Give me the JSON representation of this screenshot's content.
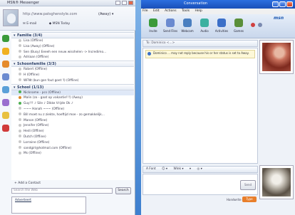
{
  "contact_list": {
    "title": "MSN® Messenger",
    "my_name": "http://www.patsghenstyle.com",
    "my_status": "(Away) ▾",
    "email_link": "E-mail",
    "news_link": "MSN Today",
    "groups": [
      {
        "name": "Familie (3/4)",
        "contacts": [
          {
            "name": "Lisa (Offline)",
            "color": "#c9c9c9"
          },
          {
            "name": "Lisa (Away) (Offline)",
            "color": "#c9c9c9"
          },
          {
            "name": "Sen (Busy) Eeeeh een neuw wisshelen -> Incredimo...",
            "color": "#c9c9c9"
          },
          {
            "name": "Adriaan (Offline)",
            "color": "#c9c9c9"
          }
        ]
      },
      {
        "name": "Schoonfamilie (3/3)",
        "contacts": [
          {
            "name": "Robert (Offline)",
            "color": "#c9c9c9"
          },
          {
            "name": "H (Offline)",
            "color": "#c9c9c9"
          },
          {
            "name": "WFNt (bun gon fout goet 'l) (Offline)",
            "color": "#c9c9c9"
          }
        ]
      },
      {
        "name": "School (1/13)",
        "contacts": [
          {
            "name": "Nickname - pcs (Offline)",
            "color": "#4caf50"
          },
          {
            "name": "Malin (zo - gaat op vakantie!!!) (Away)",
            "color": "#e08a2a"
          },
          {
            "name": "Guy!!! ♪  Sile  ♪ Dikke Vrijde Ok  ♪",
            "color": "#4caf50"
          },
          {
            "name": "~~~ Hanah ~~~ (Offline)",
            "color": "#c9c9c9"
          },
          {
            "name": "Bill moet nu z ziekte, hoeftijd moe - zo gemakkelijk...",
            "color": "#c9c9c9"
          },
          {
            "name": "Manon (Offline)",
            "color": "#c9c9c9"
          },
          {
            "name": "Jennifer (Offline)",
            "color": "#c9c9c9"
          },
          {
            "name": "Hedi (Offline)",
            "color": "#c9c9c9"
          },
          {
            "name": "Dutch (Offline)",
            "color": "#c9c9c9"
          },
          {
            "name": "Lorraine (Offline)",
            "color": "#c9c9c9"
          },
          {
            "name": "sandgirl@hotmail.com (Offline)",
            "color": "#c9c9c9"
          },
          {
            "name": "Ms (Offline)",
            "color": "#c9c9c9"
          }
        ]
      }
    ],
    "add_contact": "+ Add a Contact",
    "search_placeholder": "Search the Web",
    "search_button": "Search",
    "ad_text": "Adverteert"
  },
  "conversation": {
    "title": "Conversation",
    "menu": [
      "File",
      "Edit",
      "Actions",
      "Tools",
      "Help"
    ],
    "toolbar": [
      "Invite",
      "Send Files",
      "Webcam",
      "Audio",
      "Activities",
      "Games"
    ],
    "logo": "msn",
    "to_label": "To: Dominico <...>",
    "warning": "Dominico ... may not reply because his or her status is set to Away.",
    "format_items": [
      "A Font",
      "☺ ▾",
      "Wink ▾",
      "▾",
      "◎ ▾"
    ],
    "send_button": "Send",
    "tab_handwrite": "Handwrite",
    "tab_type": "Type"
  },
  "colors": {
    "accent": "#1a56b0",
    "title_bar": "#2c6fe0",
    "type_tab": "#e87e2a"
  },
  "icons": [
    "contact-list-icon",
    "buddy-icon",
    "gear-icon",
    "star-icon"
  ]
}
